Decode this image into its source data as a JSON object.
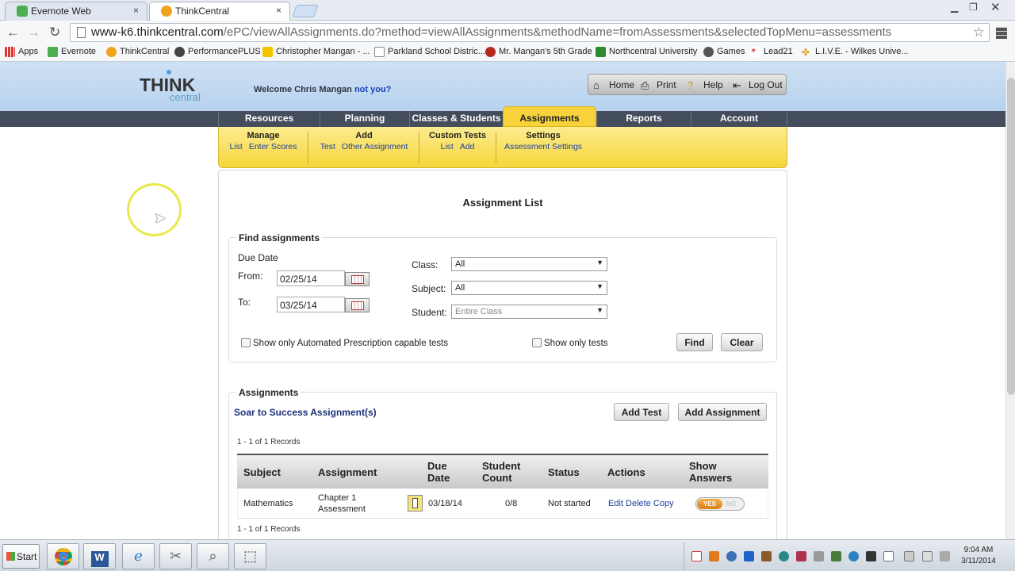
{
  "browser": {
    "tabs": [
      {
        "label": "Evernote Web",
        "close": "×"
      },
      {
        "label": "ThinkCentral",
        "close": "×"
      }
    ],
    "url_host": "www-k6.thinkcentral.com",
    "url_path": "/ePC/viewAllAssignments.do?method=viewAllAssignments&methodName=fromAssessments&selectedTopMenu=assessments",
    "bookmarks": [
      "Apps",
      "Evernote",
      "ThinkCentral",
      "PerformancePLUS",
      "Christopher Mangan - ...",
      "Parkland School Distric...",
      "Mr. Mangan's 5th Grade",
      "Northcentral University",
      "Games",
      "Lead21",
      "L.I.V.E. - Wilkes Unive..."
    ]
  },
  "header": {
    "logo_think": "THINK",
    "logo_central": "central",
    "welcome": "Welcome Chris Mangan",
    "not_you": "not you?",
    "util": {
      "home": "Home",
      "print": "Print",
      "help": "Help",
      "logout": "Log Out"
    }
  },
  "nav": {
    "tabs": [
      "Resources",
      "Planning",
      "Classes & Students",
      "Assignments",
      "Reports",
      "Account"
    ]
  },
  "subnav": {
    "manage": {
      "title": "Manage",
      "links": [
        "List",
        "Enter Scores"
      ]
    },
    "add": {
      "title": "Add",
      "links": [
        "Test",
        "Other Assignment"
      ]
    },
    "custom": {
      "title": "Custom Tests",
      "links": [
        "List",
        "Add"
      ]
    },
    "settings": {
      "title": "Settings",
      "links": [
        "Assessment Settings"
      ]
    }
  },
  "page_title": "Assignment List",
  "find": {
    "legend": "Find assignments",
    "due_date": "Due Date",
    "from_label": "From:",
    "from_value": "02/25/14",
    "to_label": "To:",
    "to_value": "03/25/14",
    "class_label": "Class:",
    "class_value": "All",
    "subject_label": "Subject:",
    "subject_value": "All",
    "student_label": "Student:",
    "student_value": "Entire Class",
    "chk_automated": "Show only Automated Prescription capable tests",
    "chk_tests": "Show only tests",
    "find_btn": "Find",
    "clear_btn": "Clear"
  },
  "assignments": {
    "legend": "Assignments",
    "soar": "Soar to Success Assignment(s)",
    "add_test": "Add Test",
    "add_assignment": "Add Assignment",
    "records_top": "1 - 1 of 1 Records",
    "records_bottom": "1 - 1 of 1 Records",
    "columns": [
      "Subject",
      "Assignment",
      "Due Date",
      "Student Count",
      "Status",
      "Actions",
      "Show Answers"
    ],
    "rows": [
      {
        "subject": "Mathematics",
        "assignment": "Chapter 1 Assessment",
        "due": "03/18/14",
        "count": "0/8",
        "status": "Not started",
        "edit": "Edit",
        "delete": "Delete",
        "copy": "Copy",
        "toggle_on": "YES",
        "toggle_off": "NO"
      }
    ]
  },
  "taskbar": {
    "start": "Start",
    "time": "9:04 AM",
    "date": "3/11/2014"
  }
}
